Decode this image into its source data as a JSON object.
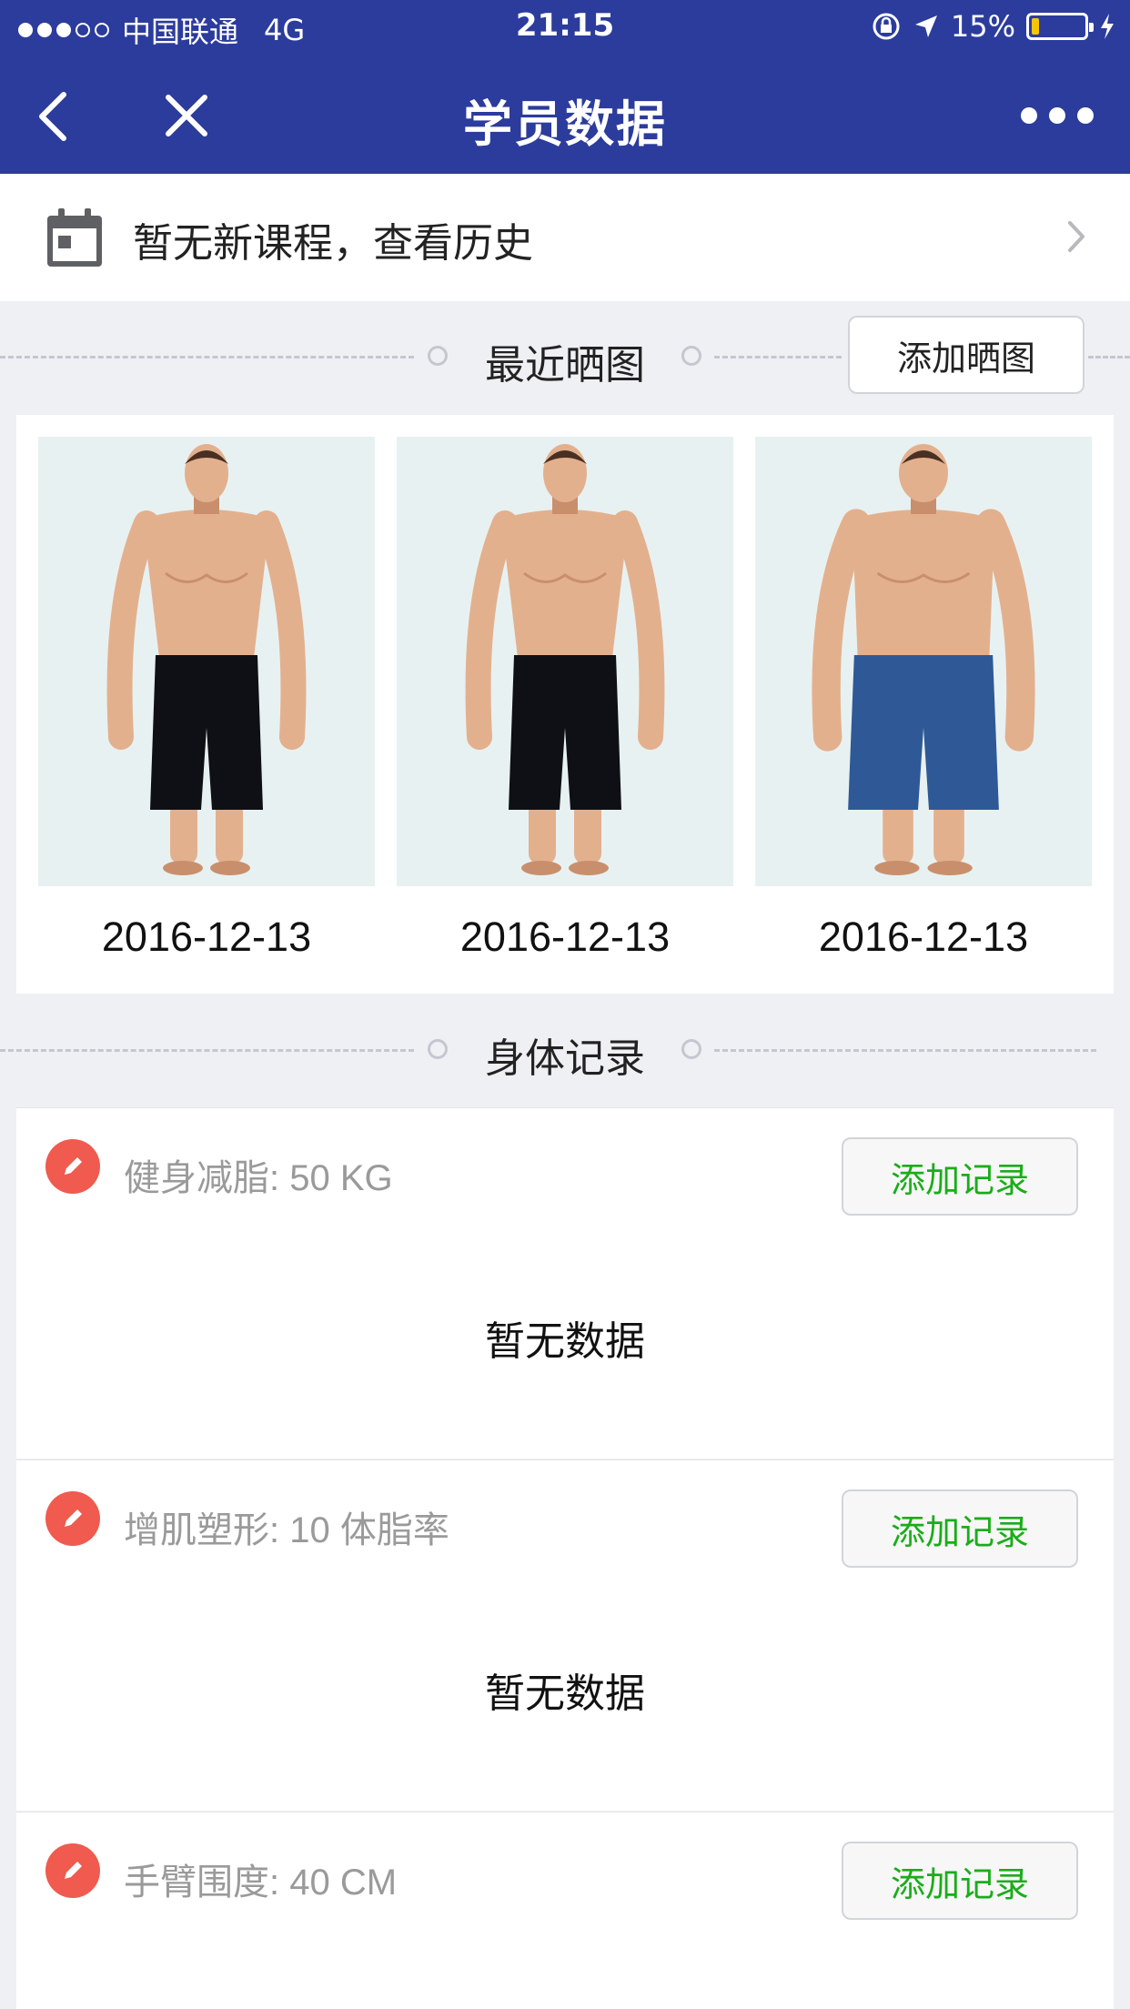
{
  "status_bar": {
    "carrier": "中国联通",
    "network": "4G",
    "time": "21:15",
    "battery_text": "15%",
    "battery_level": 0.15,
    "signal_bars_filled": 3,
    "signal_bars_total": 5,
    "battery_color": "#f7c600"
  },
  "navbar": {
    "title": "学员数据",
    "back_icon": "chevron-left-icon",
    "close_icon": "close-icon",
    "more_icon": "more-horizontal-icon",
    "color": "#2c3c9c"
  },
  "course": {
    "icon": "calendar-icon",
    "text": "暂无新课程，查看历史"
  },
  "recent_photos": {
    "section_title": "最近晒图",
    "add_button": "添加晒图",
    "items": [
      {
        "date": "2016-12-13",
        "shorts_color": "#0e1016",
        "body": "lean"
      },
      {
        "date": "2016-12-13",
        "shorts_color": "#0e1016",
        "body": "lean"
      },
      {
        "date": "2016-12-13",
        "shorts_color": "#2f5996",
        "body": "heavy"
      }
    ]
  },
  "body_records": {
    "section_title": "身体记录",
    "accent": "#1aad19",
    "edit_color": "#f05a4f",
    "items": [
      {
        "title": "健身减脂: 50 KG",
        "add_button": "添加记录",
        "empty_text": "暂无数据"
      },
      {
        "title": "增肌塑形: 10 体脂率",
        "add_button": "添加记录",
        "empty_text": "暂无数据"
      },
      {
        "title": "手臂围度: 40 CM",
        "add_button": "添加记录",
        "empty_text": ""
      }
    ]
  }
}
